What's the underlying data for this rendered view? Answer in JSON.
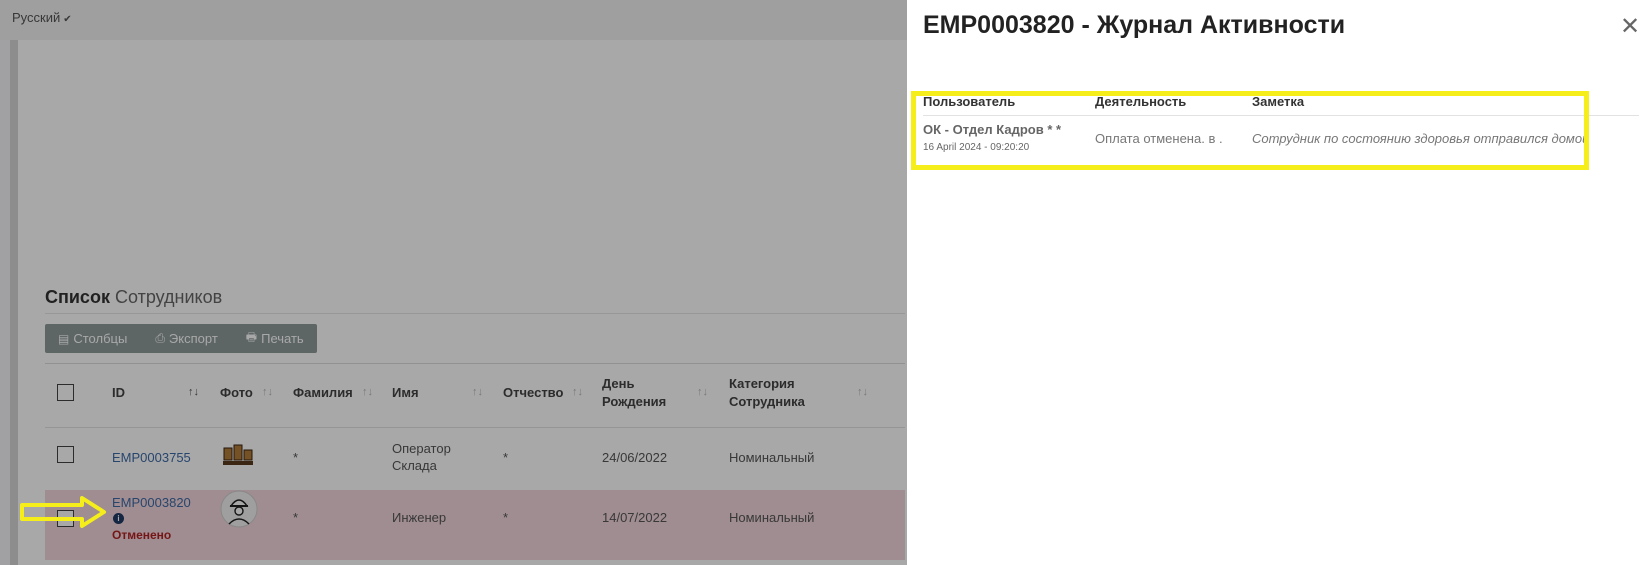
{
  "header": {
    "language": "Русский"
  },
  "list": {
    "title_bold": "Список",
    "title_light": "Сотрудников",
    "toolbar": {
      "columns": "Столбцы",
      "export": "Экспорт",
      "print": "Печать"
    },
    "columns": [
      "ID",
      "Фото",
      "Фамилия",
      "Имя",
      "Отчество",
      "День Рождения",
      "Категория Сотрудника"
    ],
    "rows": [
      {
        "id": "EMP0003755",
        "surname": "*",
        "name": "Оператор Склада",
        "patronymic": "*",
        "birthday": "24/06/2022",
        "category": "Номинальный"
      },
      {
        "id": "EMP0003820",
        "status": "Отменено",
        "surname": "*",
        "name": "Инженер",
        "patronymic": "*",
        "birthday": "14/07/2022",
        "category": "Номинальный"
      }
    ]
  },
  "drawer": {
    "title": "EMP0003820 - Журнал Активности",
    "close": "✕",
    "columns": {
      "user": "Пользователь",
      "activity": "Деятельность",
      "note": "Заметка"
    },
    "entries": [
      {
        "user": "ОК - Отдел Кадров * *",
        "date": "16 April 2024 - 09:20:20",
        "activity": "Оплата отменена. в .",
        "note": "Сотрудник по состоянию здоровья отправился домой"
      }
    ]
  },
  "colors": {
    "highlight": "#f5ee1b",
    "link": "#3d6aa6",
    "cancel_row": "#f3d6dc",
    "cancel_text": "#b22222"
  }
}
